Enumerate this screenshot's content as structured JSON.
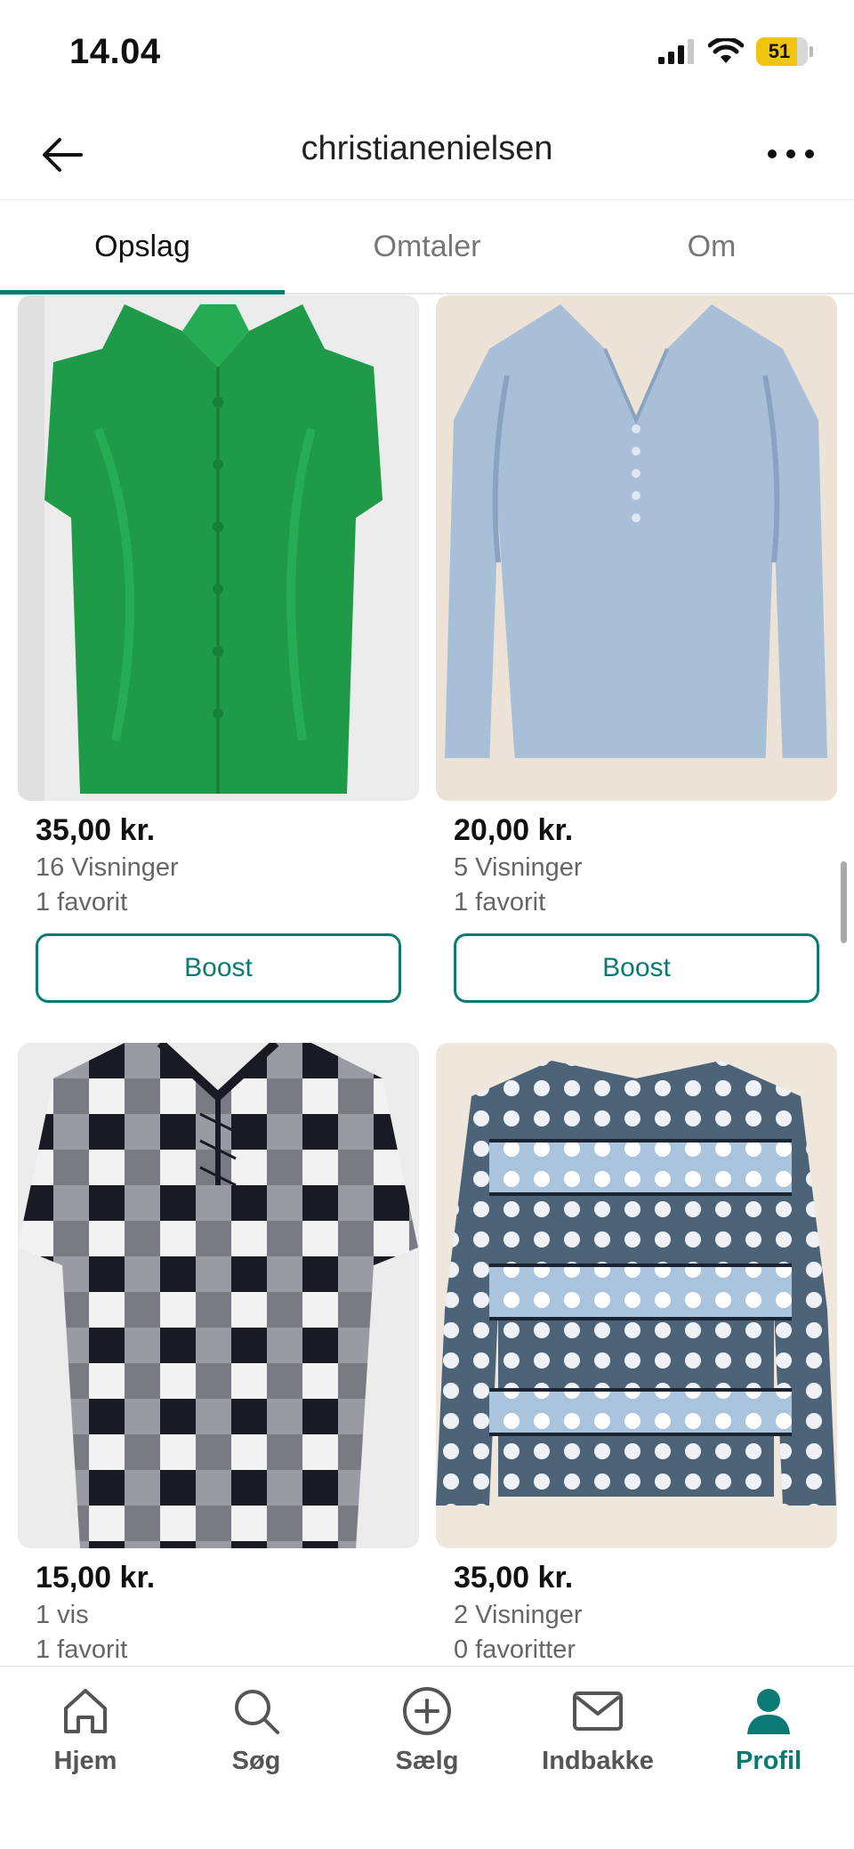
{
  "status_bar": {
    "time": "14.04",
    "battery": "51"
  },
  "header": {
    "title": "christianenielsen"
  },
  "tabs": [
    {
      "label": "Opslag",
      "active": true
    },
    {
      "label": "Omtaler",
      "active": false
    },
    {
      "label": "Om",
      "active": false
    }
  ],
  "listings": [
    {
      "price": "35,00 kr.",
      "views": "16 Visninger",
      "favorites": "1 favorit",
      "boost_label": "Boost",
      "image": "green leather shirt"
    },
    {
      "price": "20,00 kr.",
      "views": "5 Visninger",
      "favorites": "1 favorit",
      "boost_label": "Boost",
      "image": "light blue blouse"
    },
    {
      "price": "15,00 kr.",
      "views": "1 vis",
      "favorites": "1 favorit",
      "image": "black white check top"
    },
    {
      "price": "35,00 kr.",
      "views": "2 Visninger",
      "favorites": "0 favoritter",
      "image": "polka dot striped sweater"
    }
  ],
  "bottom_nav": [
    {
      "label": "Hjem",
      "icon": "home-icon"
    },
    {
      "label": "Søg",
      "icon": "search-icon"
    },
    {
      "label": "Sælg",
      "icon": "plus-circle-icon"
    },
    {
      "label": "Indbakke",
      "icon": "mail-icon"
    },
    {
      "label": "Profil",
      "icon": "profile-icon",
      "active": true
    }
  ],
  "colors": {
    "accent": "#0b7a75"
  }
}
